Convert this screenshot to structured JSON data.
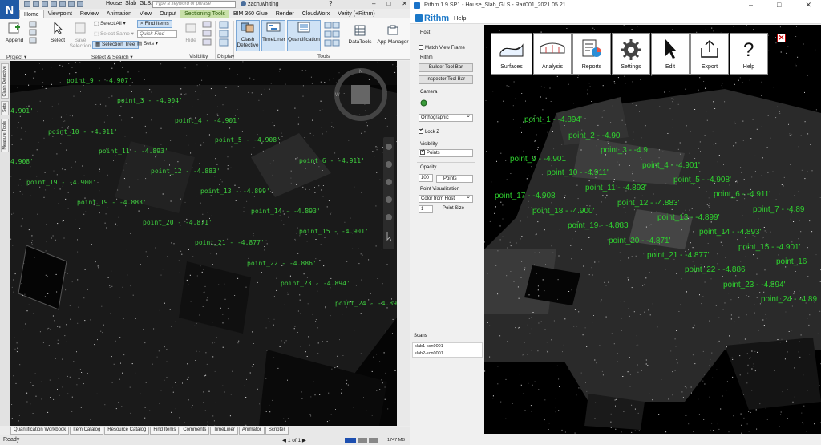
{
  "navisworks": {
    "logo": "N",
    "doc_title": "House_Slab_GLS...",
    "search_placeholder": "Type a keyword or phrase",
    "user": "zach.whiting",
    "help_glyph": "?",
    "tabs": [
      "Home",
      "Viewpoint",
      "Review",
      "Animation",
      "View",
      "Output",
      "Sectioning Tools",
      "BIM 360 Glue",
      "Render",
      "CloudWorx",
      "Verity (+Rithm)"
    ],
    "active_tab": "Home",
    "ribbon": {
      "append": "Append",
      "select": "Select",
      "save_selection": "Save Selection",
      "select_all": "Select All",
      "select_same": "Select Same",
      "selection_tree": "Selection Tree",
      "find_items": "Find Items",
      "quick_find": "Quick Find",
      "sets": "Sets",
      "hide": "Hide",
      "clash_detective": "Clash Detective",
      "timeliner": "TimeLiner",
      "quantification": "Quantification",
      "datatools": "DataTools",
      "app_manager": "App Manager",
      "groups": {
        "project": "Project",
        "select_search": "Select & Search",
        "visibility": "Visibility",
        "display": "Display",
        "tools": "Tools"
      }
    },
    "side_tabs": [
      "Clash Detective",
      "Sets",
      "Measure Tools"
    ],
    "bottom_tabs": [
      "Quantification Workbook",
      "Item Catalog",
      "Resource Catalog",
      "Find Items",
      "Comments",
      "TimeLiner",
      "Animator",
      "Scripter"
    ],
    "status": {
      "ready": "Ready",
      "pager": "1 of 1",
      "memory": "1747 MB"
    },
    "labels": [
      "point_9 - -4.907'",
      "point_3 - -4.904'",
      "point_4 - -4.901'",
      "point_10 - -4.911'",
      "point_11 - -4.893'",
      "point_5 - -4.908'",
      "point_12 - -4.883'",
      "point_6 - -4.911'",
      "point_13 - -4.899'",
      "point_18 - -4.900'",
      "point_19 - -4.883'",
      "point_14 - -4.893'",
      "point_20 - -4.871'",
      "point_15 - -4.901'",
      "point_21 - -4.877'",
      "point_22 - -4.886'",
      "point_23 - -4.894'",
      "point_24 - -4.891'",
      "4.901'",
      "4.908'",
      "point_19 - -4.900'"
    ]
  },
  "rithm": {
    "window_title": "Rithm 1.9 SP1 - House_Slab_GLS - Rait001_2021.05.21",
    "brand": "Rithm",
    "help_menu": "Help",
    "panel": {
      "host": "Host",
      "match_view_frame": "Match View Frame",
      "rithm": "Rithm",
      "builder_tool_bar": "Builder Tool Bar",
      "inspector_tool_bar": "Inspector Tool Bar",
      "camera": "Camera",
      "projection": "Orthographic",
      "lock_z": "Lock Z",
      "visibility": "Visibility",
      "points": "Points",
      "opacity": "Opacity",
      "opacity_value": "100",
      "opacity_unit": "Points",
      "point_visualization": "Point Visualization",
      "color_mode": "Color from Host",
      "point_size_value": "1",
      "point_size": "Point Size",
      "scans": "Scans",
      "scan_list": [
        "slab1-scn0001",
        "slab2-scn0001"
      ]
    },
    "toolbar": [
      "Surfaces",
      "Analysis",
      "Reports",
      "Settings",
      "Edit",
      "Export",
      "Help"
    ],
    "close_glyph": "✕",
    "labels": [
      "point_1 - -4.894'",
      "point_2 - -4.90",
      "point_3 - -4.9",
      "point_9 - -4.901",
      "point_4 - -4.901'",
      "point_10 - -4.911'",
      "point_5 - -4.908'",
      "point_11 - -4.893'",
      "point_6 - -4.911'",
      "point_17 - -4.908'",
      "point_12 - -4.883'",
      "point_7 - -4.89",
      "point_18 - -4.900'",
      "point_13 - -4.899'",
      "point_19 - -4.883'",
      "point_14 - -4.893'",
      "point_20 - -4.871'",
      "point_15 - -4.901'",
      "point_21 - -4.877'",
      "point_16",
      "point_22 - -4.886'",
      "point_23 - -4.894'",
      "point_24 - -4.89"
    ]
  }
}
